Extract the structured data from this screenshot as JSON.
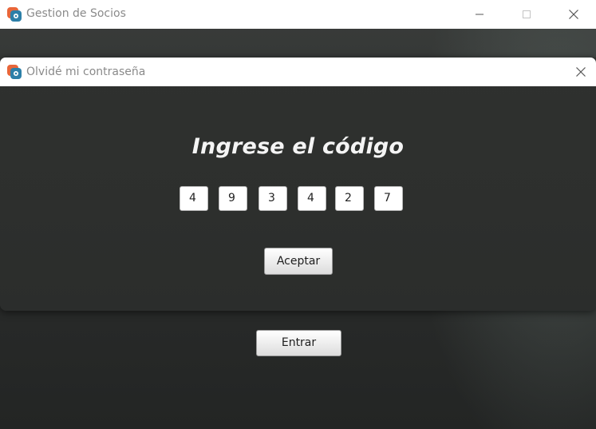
{
  "main_window": {
    "title": "Gestion de Socios",
    "minimize_glyph": "minimize-icon",
    "maximize_glyph": "maximize-icon",
    "close_glyph": "close-icon",
    "enter_button_label": "Entrar"
  },
  "dialog": {
    "title": "Olvidé mi contraseña",
    "heading": "Ingrese el código",
    "code_digits": [
      "4",
      "9",
      "3",
      "4",
      "2",
      "7"
    ],
    "accept_button_label": "Aceptar"
  },
  "colors": {
    "app_icon_orange": "#e8663a",
    "app_icon_teal": "#2c7fa8",
    "titlebar_text": "#8a8a8a",
    "background": "#2c2e2d"
  }
}
